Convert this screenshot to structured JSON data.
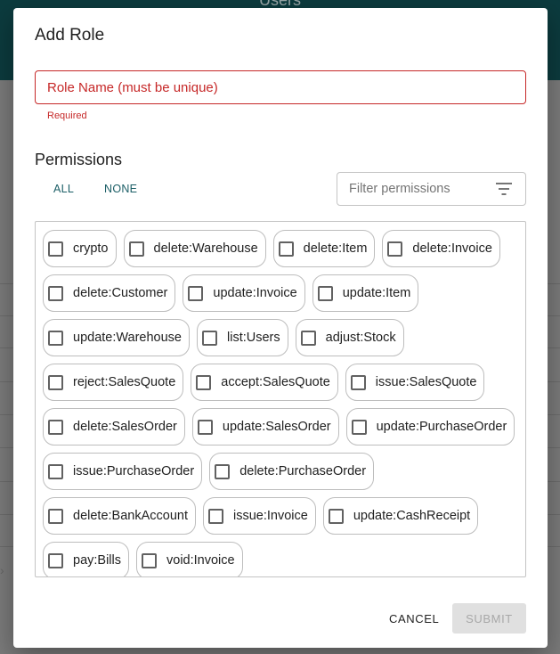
{
  "background": {
    "title": "Users"
  },
  "dialog": {
    "title": "Add Role",
    "role_name": {
      "value": "",
      "placeholder": "Role Name (must be unique)",
      "helper": "Required"
    },
    "permissions": {
      "title": "Permissions",
      "all_label": "ALL",
      "none_label": "NONE",
      "filter_placeholder": "Filter permissions",
      "items": [
        {
          "label": "crypto",
          "checked": false
        },
        {
          "label": "delete:Warehouse",
          "checked": false
        },
        {
          "label": "delete:Item",
          "checked": false
        },
        {
          "label": "delete:Invoice",
          "checked": false
        },
        {
          "label": "delete:Customer",
          "checked": false
        },
        {
          "label": "update:Invoice",
          "checked": false
        },
        {
          "label": "update:Item",
          "checked": false
        },
        {
          "label": "update:Warehouse",
          "checked": false
        },
        {
          "label": "list:Users",
          "checked": false
        },
        {
          "label": "adjust:Stock",
          "checked": false
        },
        {
          "label": "reject:SalesQuote",
          "checked": false
        },
        {
          "label": "accept:SalesQuote",
          "checked": false
        },
        {
          "label": "issue:SalesQuote",
          "checked": false
        },
        {
          "label": "delete:SalesOrder",
          "checked": false
        },
        {
          "label": "update:SalesOrder",
          "checked": false
        },
        {
          "label": "update:PurchaseOrder",
          "checked": false
        },
        {
          "label": "issue:PurchaseOrder",
          "checked": false
        },
        {
          "label": "delete:PurchaseOrder",
          "checked": false
        },
        {
          "label": "delete:BankAccount",
          "checked": false
        },
        {
          "label": "issue:Invoice",
          "checked": false
        },
        {
          "label": "update:CashReceipt",
          "checked": false
        },
        {
          "label": "pay:Bills",
          "checked": false
        },
        {
          "label": "void:Invoice",
          "checked": false
        }
      ]
    },
    "cancel_label": "CANCEL",
    "submit_label": "SUBMIT"
  },
  "colors": {
    "error": "#c62828",
    "accent": "#1b5e66",
    "header": "#0c3b3e"
  }
}
